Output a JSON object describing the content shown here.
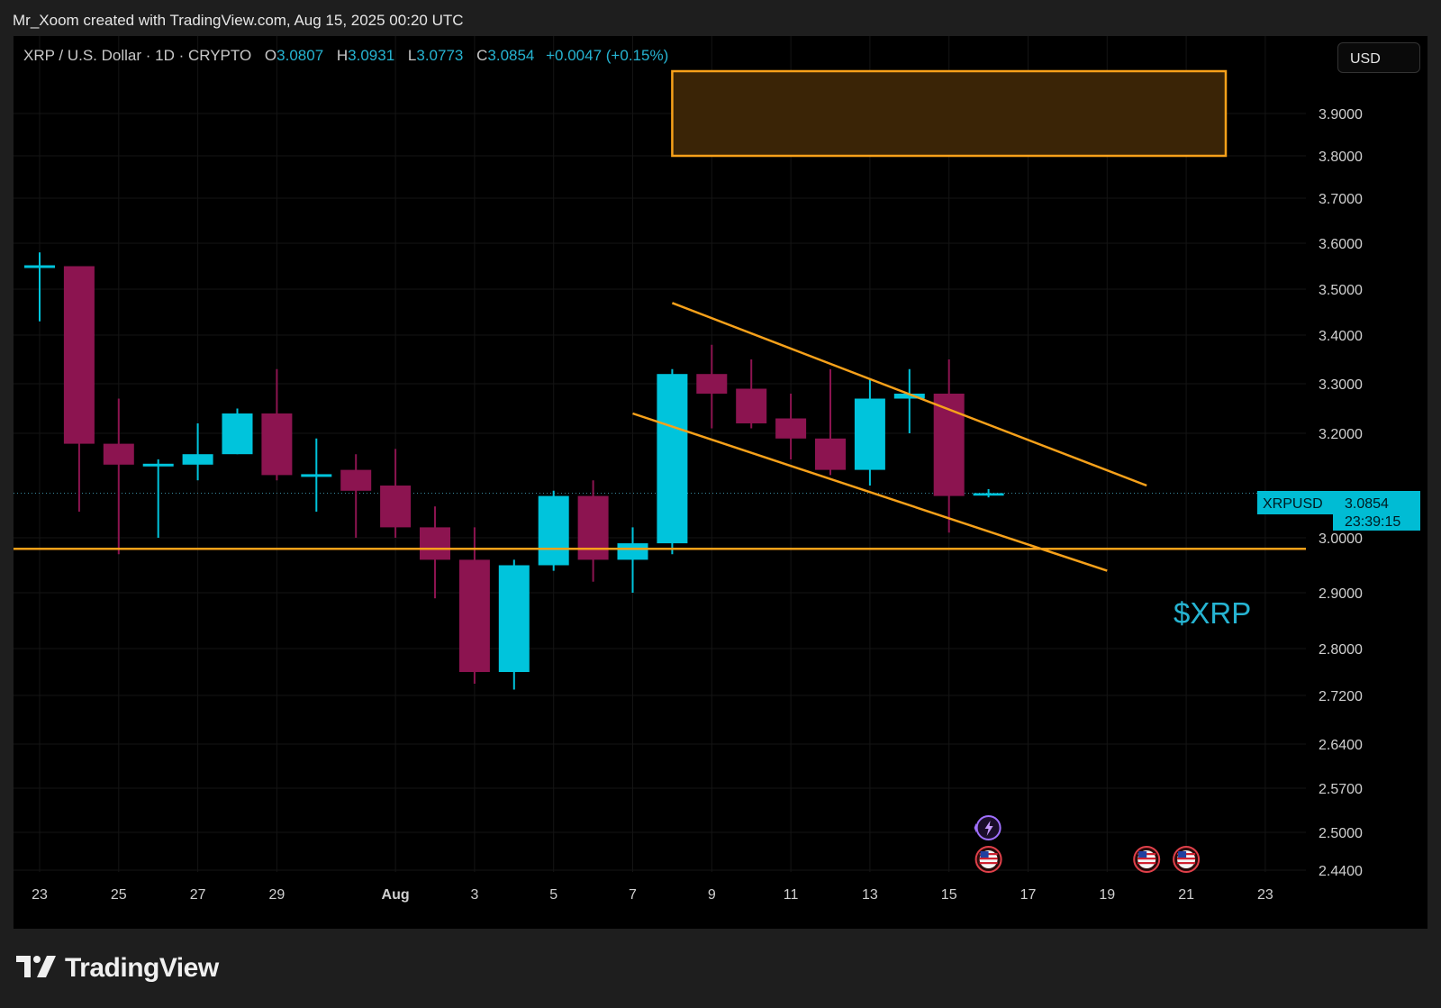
{
  "header": {
    "attribution": "Mr_Xoom created with TradingView.com, Aug 15, 2025 00:20 UTC"
  },
  "legend": {
    "symbol": "XRP / U.S. Dollar · 1D · CRYPTO",
    "open_key": "O",
    "open": "3.0807",
    "high_key": "H",
    "high": "3.0931",
    "low_key": "L",
    "low": "3.0773",
    "close_key": "C",
    "close": "3.0854",
    "change": "+0.0047 (+0.15%)"
  },
  "currency_button": "USD",
  "price_tag": {
    "symbol": "XRPUSD",
    "price": "3.0854",
    "countdown": "23:39:15"
  },
  "annotation_text": "$XRP",
  "brand": {
    "name": "TradingView"
  },
  "colors": {
    "up": "#00c4dc",
    "down": "#8c1450",
    "line": "#f7a11a",
    "zone_fill": "#3a2406",
    "zone_stroke": "#f7a11a",
    "price_line": "#3a8aa0"
  },
  "chart_data": {
    "type": "candlestick",
    "y_ticks": [
      "3.9000",
      "3.8000",
      "3.7000",
      "3.6000",
      "3.5000",
      "3.4000",
      "3.3000",
      "3.2000",
      "3.0000",
      "2.9000",
      "2.8000",
      "2.7200",
      "2.6400",
      "2.5700",
      "2.5000",
      "2.4400"
    ],
    "x_ticks": [
      {
        "label": "23",
        "i": 0
      },
      {
        "label": "25",
        "i": 2
      },
      {
        "label": "27",
        "i": 4
      },
      {
        "label": "29",
        "i": 6
      },
      {
        "label": "Aug",
        "i": 9
      },
      {
        "label": "3",
        "i": 11
      },
      {
        "label": "5",
        "i": 13
      },
      {
        "label": "7",
        "i": 15
      },
      {
        "label": "9",
        "i": 17
      },
      {
        "label": "11",
        "i": 19
      },
      {
        "label": "13",
        "i": 21
      },
      {
        "label": "15",
        "i": 23
      },
      {
        "label": "17",
        "i": 25
      },
      {
        "label": "19",
        "i": 27
      },
      {
        "label": "21",
        "i": 29
      },
      {
        "label": "23",
        "i": 31
      }
    ],
    "candles": [
      {
        "date": "Jul 22",
        "o": 3.55,
        "h": 3.58,
        "l": 3.43,
        "c": 3.55
      },
      {
        "date": "Jul 23",
        "o": 3.55,
        "h": 3.55,
        "l": 3.05,
        "c": 3.18
      },
      {
        "date": "Jul 24",
        "o": 3.18,
        "h": 3.27,
        "l": 2.97,
        "c": 3.14
      },
      {
        "date": "Jul 25",
        "o": 3.14,
        "h": 3.15,
        "l": 3.0,
        "c": 3.14
      },
      {
        "date": "Jul 26",
        "o": 3.14,
        "h": 3.22,
        "l": 3.11,
        "c": 3.16
      },
      {
        "date": "Jul 27",
        "o": 3.16,
        "h": 3.25,
        "l": 3.16,
        "c": 3.24
      },
      {
        "date": "Jul 28",
        "o": 3.24,
        "h": 3.33,
        "l": 3.11,
        "c": 3.12
      },
      {
        "date": "Jul 29",
        "o": 3.12,
        "h": 3.19,
        "l": 3.05,
        "c": 3.12
      },
      {
        "date": "Jul 30",
        "o": 3.13,
        "h": 3.16,
        "l": 3.0,
        "c": 3.09
      },
      {
        "date": "Jul 31",
        "o": 3.1,
        "h": 3.17,
        "l": 3.0,
        "c": 3.02
      },
      {
        "date": "Aug 1",
        "o": 3.02,
        "h": 3.06,
        "l": 2.89,
        "c": 2.96
      },
      {
        "date": "Aug 2",
        "o": 2.96,
        "h": 3.02,
        "l": 2.74,
        "c": 2.76
      },
      {
        "date": "Aug 3",
        "o": 2.76,
        "h": 2.96,
        "l": 2.73,
        "c": 2.95
      },
      {
        "date": "Aug 4",
        "o": 2.95,
        "h": 3.09,
        "l": 2.94,
        "c": 3.08
      },
      {
        "date": "Aug 5",
        "o": 3.08,
        "h": 3.11,
        "l": 2.92,
        "c": 2.96
      },
      {
        "date": "Aug 6",
        "o": 2.96,
        "h": 3.02,
        "l": 2.9,
        "c": 2.99
      },
      {
        "date": "Aug 7",
        "o": 2.99,
        "h": 3.33,
        "l": 2.97,
        "c": 3.32
      },
      {
        "date": "Aug 8",
        "o": 3.32,
        "h": 3.38,
        "l": 3.21,
        "c": 3.28
      },
      {
        "date": "Aug 9",
        "o": 3.29,
        "h": 3.35,
        "l": 3.21,
        "c": 3.22
      },
      {
        "date": "Aug 10",
        "o": 3.23,
        "h": 3.28,
        "l": 3.15,
        "c": 3.19
      },
      {
        "date": "Aug 11",
        "o": 3.19,
        "h": 3.33,
        "l": 3.12,
        "c": 3.13
      },
      {
        "date": "Aug 12",
        "o": 3.13,
        "h": 3.31,
        "l": 3.1,
        "c": 3.27
      },
      {
        "date": "Aug 13",
        "o": 3.27,
        "h": 3.33,
        "l": 3.2,
        "c": 3.28
      },
      {
        "date": "Aug 14",
        "o": 3.28,
        "h": 3.35,
        "l": 3.01,
        "c": 3.08
      },
      {
        "date": "Aug 15",
        "o": 3.0807,
        "h": 3.0931,
        "l": 3.0773,
        "c": 3.0854
      }
    ],
    "current_price": 3.0854,
    "drawings": {
      "support_level": 2.98,
      "zone": {
        "start_date": "Aug 7",
        "end_date": "Aug 21",
        "top": 4.0,
        "bottom": 3.8
      },
      "upper_trendline": [
        {
          "date": "Aug 7",
          "price": 3.47
        },
        {
          "date": "Aug 19",
          "price": 3.1
        }
      ],
      "lower_trendline": [
        {
          "date": "Aug 6",
          "price": 3.24
        },
        {
          "date": "Aug 18",
          "price": 2.94
        }
      ]
    },
    "event_markers": [
      {
        "date": "Aug 15",
        "kind": "earnings"
      },
      {
        "date": "Aug 15",
        "kind": "us-economic-event"
      },
      {
        "date": "Aug 19",
        "kind": "us-economic-event"
      },
      {
        "date": "Aug 20",
        "kind": "us-economic-event"
      }
    ]
  }
}
